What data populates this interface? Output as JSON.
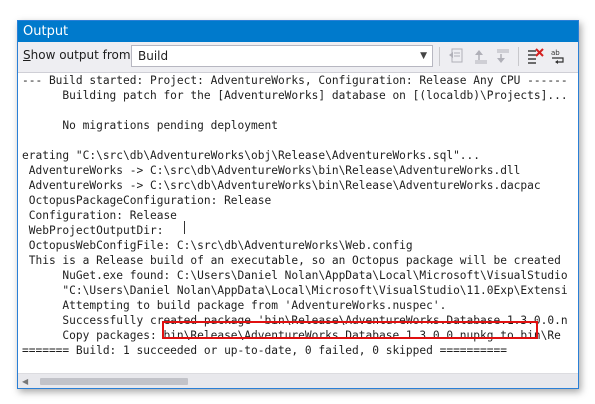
{
  "window": {
    "title": "Output"
  },
  "toolbar": {
    "show_output_label_prefix": "S",
    "show_output_label_rest": "how output from:",
    "selected_source": "Build",
    "buttons": [
      {
        "name": "go-to-error-icon"
      },
      {
        "name": "previous-message-icon"
      },
      {
        "name": "next-message-icon"
      },
      {
        "name": "clear-all-icon"
      },
      {
        "name": "toggle-word-wrap-icon"
      }
    ]
  },
  "output": {
    "lines": [
      "--- Build started: Project: AdventureWorks, Configuration: Release Any CPU ------",
      "      Building patch for the [AdventureWorks] database on [(localdb)\\Projects]...",
      "",
      "      No migrations pending deployment",
      "",
      "erating \"C:\\src\\db\\AdventureWorks\\obj\\Release\\AdventureWorks.sql\"...",
      " AdventureWorks -> C:\\src\\db\\AdventureWorks\\bin\\Release\\AdventureWorks.dll",
      " AdventureWorks -> C:\\src\\db\\AdventureWorks\\bin\\Release\\AdventureWorks.dacpac",
      " OctopusPackageConfiguration: Release",
      " Configuration: Release",
      " WebProjectOutputDir:",
      " OctopusWebConfigFile: C:\\src\\db\\AdventureWorks\\Web.config",
      " This is a Release build of an executable, so an Octopus package will be created",
      "      NuGet.exe found: C:\\Users\\Daniel Nolan\\AppData\\Local\\Microsoft\\VisualStudio",
      "      \"C:\\Users\\Daniel Nolan\\AppData\\Local\\Microsoft\\VisualStudio\\11.0Exp\\Extensi",
      "      Attempting to build package from 'AdventureWorks.nuspec'.",
      "      Successfully created package 'bin\\Release\\AdventureWorks.Database.1.3.0.0.n",
      "      Copy packages: bin\\Release\\AdventureWorks.Database.1.3.0.0.nupkg to bin\\Re",
      "======= Build: 1 succeeded or up-to-date, 0 failed, 0 skipped =========="
    ]
  },
  "colors": {
    "title_bar": "#007acc",
    "highlight": "#e01010"
  }
}
